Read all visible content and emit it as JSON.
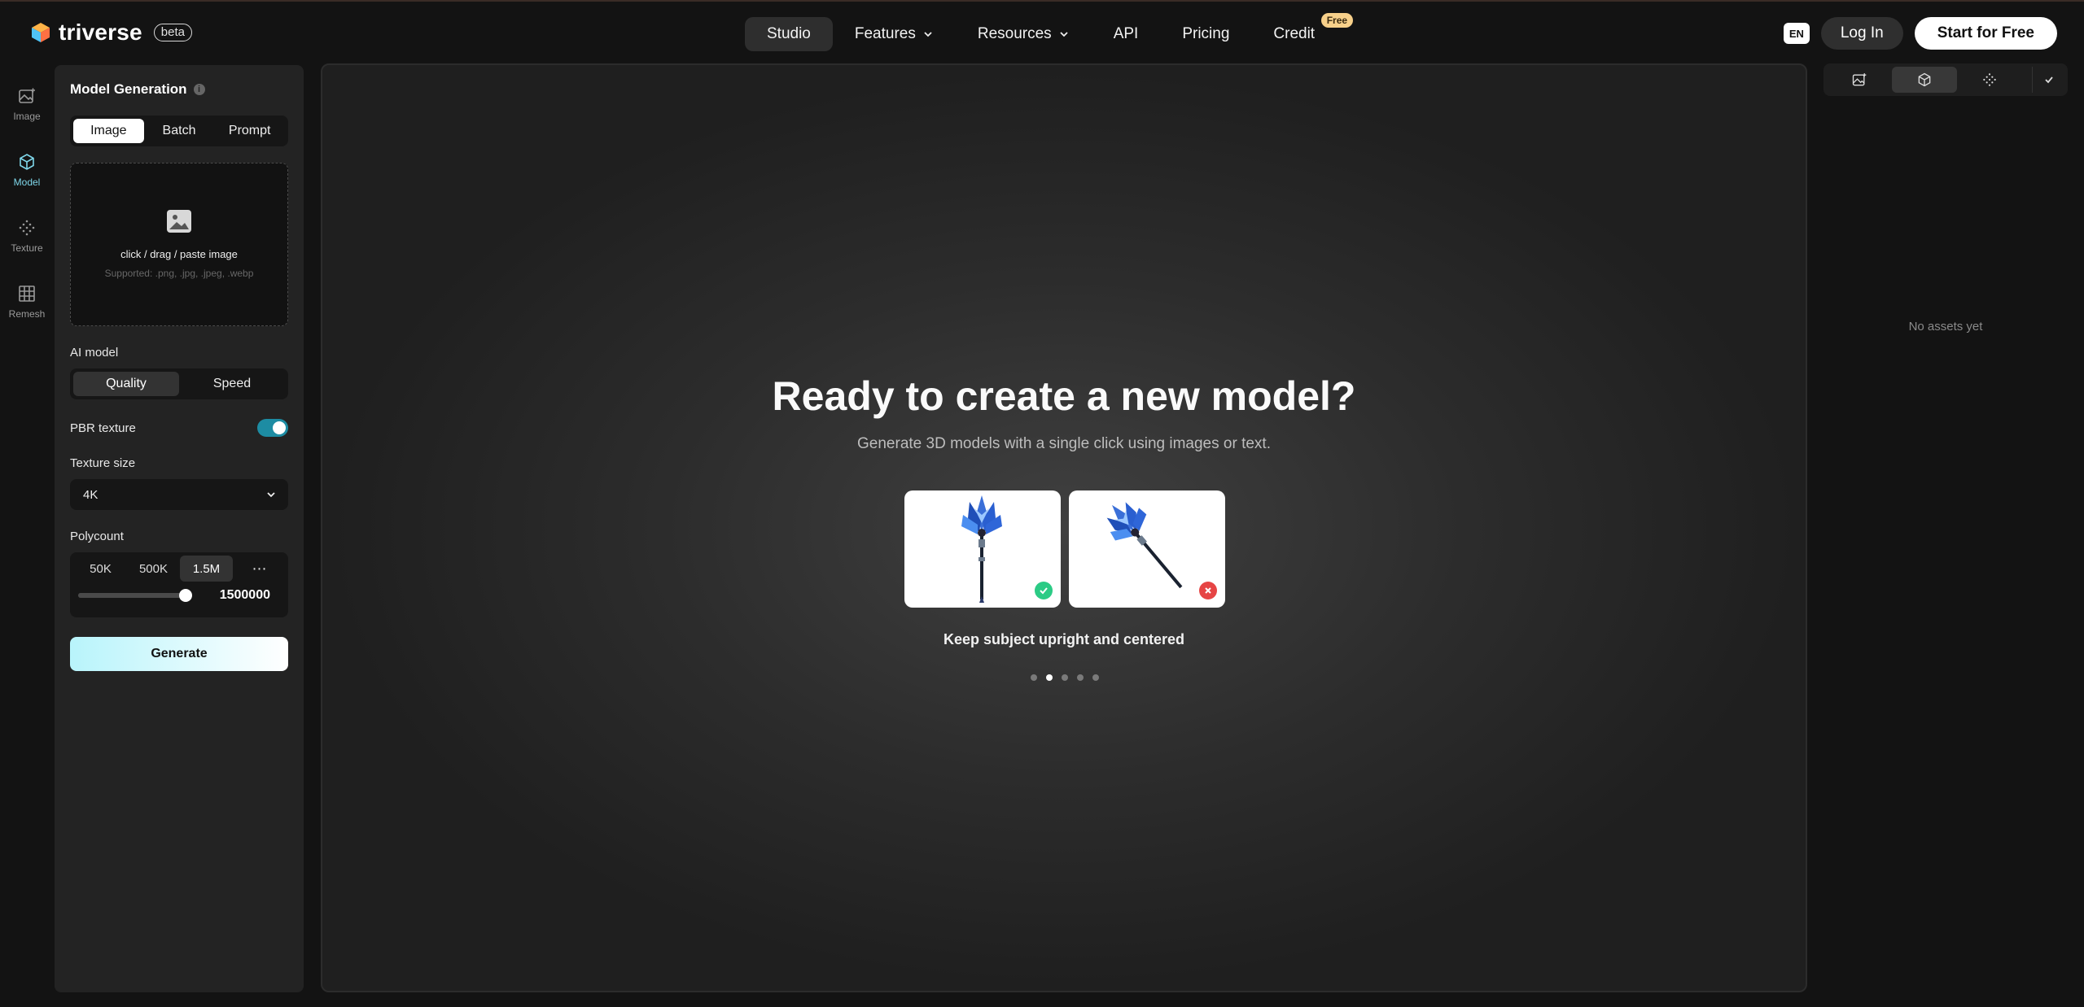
{
  "brand": {
    "name": "triverse",
    "badge": "beta"
  },
  "nav": {
    "items": [
      {
        "label": "Studio",
        "active": true,
        "dropdown": false
      },
      {
        "label": "Features",
        "active": false,
        "dropdown": true
      },
      {
        "label": "Resources",
        "active": false,
        "dropdown": true
      },
      {
        "label": "API",
        "active": false,
        "dropdown": false
      },
      {
        "label": "Pricing",
        "active": false,
        "dropdown": false
      },
      {
        "label": "Credit",
        "active": false,
        "dropdown": false,
        "badge": "Free"
      }
    ]
  },
  "header_actions": {
    "language": "EN",
    "login": "Log In",
    "start": "Start for Free"
  },
  "rail": [
    {
      "label": "Image",
      "icon": "image-edit-icon",
      "active": false
    },
    {
      "label": "Model",
      "icon": "cube-icon",
      "active": true
    },
    {
      "label": "Texture",
      "icon": "texture-dots-icon",
      "active": false
    },
    {
      "label": "Remesh",
      "icon": "grid-icon",
      "active": false
    }
  ],
  "panel": {
    "title": "Model Generation",
    "info_icon": "i",
    "input_tabs": [
      {
        "label": "Image",
        "active": true
      },
      {
        "label": "Batch",
        "active": false
      },
      {
        "label": "Prompt",
        "active": false
      }
    ],
    "upload": {
      "text": "click / drag / paste image",
      "hint": "Supported: .png, .jpg, .jpeg, .webp"
    },
    "ai_model": {
      "label": "AI model",
      "options": [
        {
          "label": "Quality",
          "active": true
        },
        {
          "label": "Speed",
          "active": false
        }
      ]
    },
    "pbr": {
      "label": "PBR texture",
      "enabled": true
    },
    "texture_size": {
      "label": "Texture size",
      "value": "4K"
    },
    "polycount": {
      "label": "Polycount",
      "options": [
        {
          "label": "50K",
          "active": false
        },
        {
          "label": "500K",
          "active": false
        },
        {
          "label": "1.5M",
          "active": true
        }
      ],
      "more": "⋯",
      "value": "1500000",
      "fraction": 1.0
    },
    "generate": "Generate"
  },
  "canvas": {
    "title": "Ready to create a new model?",
    "subtitle": "Generate 3D models with a single click using images or text.",
    "examples": [
      {
        "name": "upright-staff",
        "result": "good"
      },
      {
        "name": "tilted-staff",
        "result": "bad"
      }
    ],
    "caption": "Keep subject upright and centered",
    "dots": {
      "count": 5,
      "active_index": 1
    }
  },
  "assets": {
    "tabs": [
      {
        "icon": "image-edit-icon",
        "active": false
      },
      {
        "icon": "cube-icon",
        "active": true
      },
      {
        "icon": "texture-dots-icon",
        "active": false
      }
    ],
    "empty_text": "No assets yet"
  },
  "colors": {
    "background": "#131313",
    "panel": "#232323",
    "accent": "#7fd7ea",
    "toggle": "#1d8ca3",
    "ok": "#2bcb85",
    "bad": "#e64545",
    "free_badge": "#f7d08a"
  }
}
